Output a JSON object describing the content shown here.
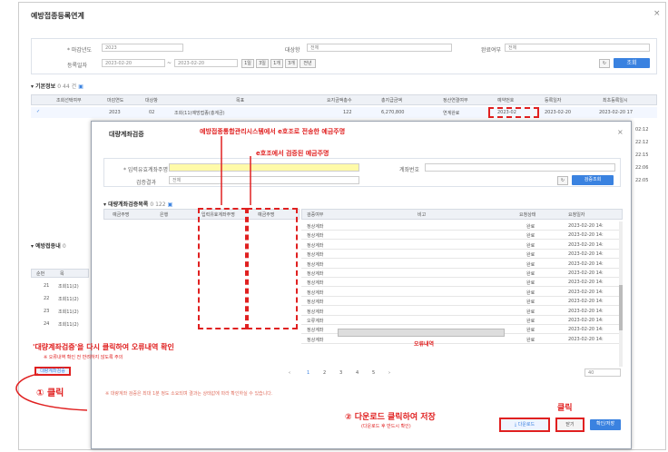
{
  "window": {
    "title": "예방접종등록연계",
    "close": "×"
  },
  "filters": {
    "year_label": "* 마감년도",
    "year_value": "2023",
    "target_label": "대상항",
    "target_value": "전체",
    "process_label": "완료여부",
    "process_value": "전체",
    "period_label": "등록일자",
    "date_from": "2023-02-20",
    "date_to": "2023-02-20",
    "quick": [
      "1일",
      "3일",
      "1개",
      "3개",
      "전년"
    ],
    "search_label": "조회"
  },
  "base_section": {
    "title": "기본정보",
    "count": "0 44 건"
  },
  "top_grid": {
    "headers": [
      "조회선택여부",
      "마감연도",
      "대상항",
      "목표",
      "요지금액총수",
      "총지급금액",
      "정산연결여부",
      "예약번호",
      "등록일자",
      "최초등록일시"
    ],
    "row": [
      "2023",
      "02",
      "조회(11)예방접종(총계금)",
      "122",
      "6,270,800",
      "연계완료",
      "2023-02",
      "2023-02-20",
      "2023-02-20 17"
    ],
    "right_times": [
      "02:12",
      "22:12",
      "22:15",
      "22:06",
      "22:05"
    ]
  },
  "mid_section": {
    "title": "예방접종내",
    "count": "0"
  },
  "left_grid": {
    "head": [
      "순번",
      "목"
    ],
    "rows": [
      [
        "21",
        "조회11(2)"
      ],
      [
        "22",
        "조회11(2)"
      ],
      [
        "23",
        "조회11(2)"
      ],
      [
        "24",
        "조회11(2)"
      ]
    ]
  },
  "modal": {
    "title": "대량계좌검증",
    "close": "×",
    "account_label": "* 입력유효계좌주명",
    "bank_label": "계좌번호",
    "status_label": "검증결과",
    "status_value": "전체",
    "search_button": "검증조회",
    "grid_title": "대량계좌검증목록",
    "grid_count": "0 122",
    "left_headers": [
      "예금주명",
      "은행",
      "입력유효계좌주명",
      "예금주명"
    ],
    "right_headers": [
      "검증여부",
      "비고",
      "요청상태",
      "요청일자"
    ],
    "rows": [
      [
        "정상계좌",
        "완료",
        "2023-02-20 14:"
      ],
      [
        "정상계좌",
        "완료",
        "2023-02-20 14:"
      ],
      [
        "정상계좌",
        "완료",
        "2023-02-20 14:"
      ],
      [
        "정상계좌",
        "완료",
        "2023-02-20 14:"
      ],
      [
        "정상계좌",
        "완료",
        "2023-02-20 14:"
      ],
      [
        "정상계좌",
        "완료",
        "2023-02-20 14:"
      ],
      [
        "정상계좌",
        "완료",
        "2023-02-20 14:"
      ],
      [
        "정상계좌",
        "완료",
        "2023-02-20 14:"
      ],
      [
        "정상계좌",
        "완료",
        "2023-02-20 14:"
      ],
      [
        "정상계좌",
        "완료",
        "2023-02-20 14:"
      ],
      [
        "오류계좌",
        "완료",
        "2023-02-20 14:"
      ],
      [
        "정상계좌",
        "완료",
        "2023-02-20 14:"
      ],
      [
        "정상계좌",
        "완료",
        "2023-02-20 14:"
      ]
    ],
    "error_note": "오류내역",
    "pages": [
      "1",
      "2",
      "3",
      "4",
      "5"
    ],
    "page_size": "40",
    "footnote": "※ 대량계좌 검증은 최대 1분 정도 소요되며 결과는 상태값에 따라 확인하실 수 있습니다.",
    "download_button": "다운로드",
    "close_button": "닫기",
    "confirm_button": "확인/저장"
  },
  "left_button": "대량계좌검증",
  "annotations": {
    "a1": "예방접종통합관리시스템에서 e호조로 전송한 예금주명",
    "a2": "e호조에서 검증된 예금주명",
    "a3": "'대량계좌검증'을 다시 클릭하여 오류내역 확인",
    "a3_sub": "※ 오류내역 확인 전 반려하지 않도록 주의",
    "step1": "① 클릭",
    "step2": "② 다운로드 클릭하여 저장",
    "step2_sub": "(다운로드 후 반드시 확인)",
    "click": "클릭"
  },
  "colors": {
    "accent": "#3a82e0",
    "annotation": "#e02020",
    "highlight": "#fffaa8"
  }
}
